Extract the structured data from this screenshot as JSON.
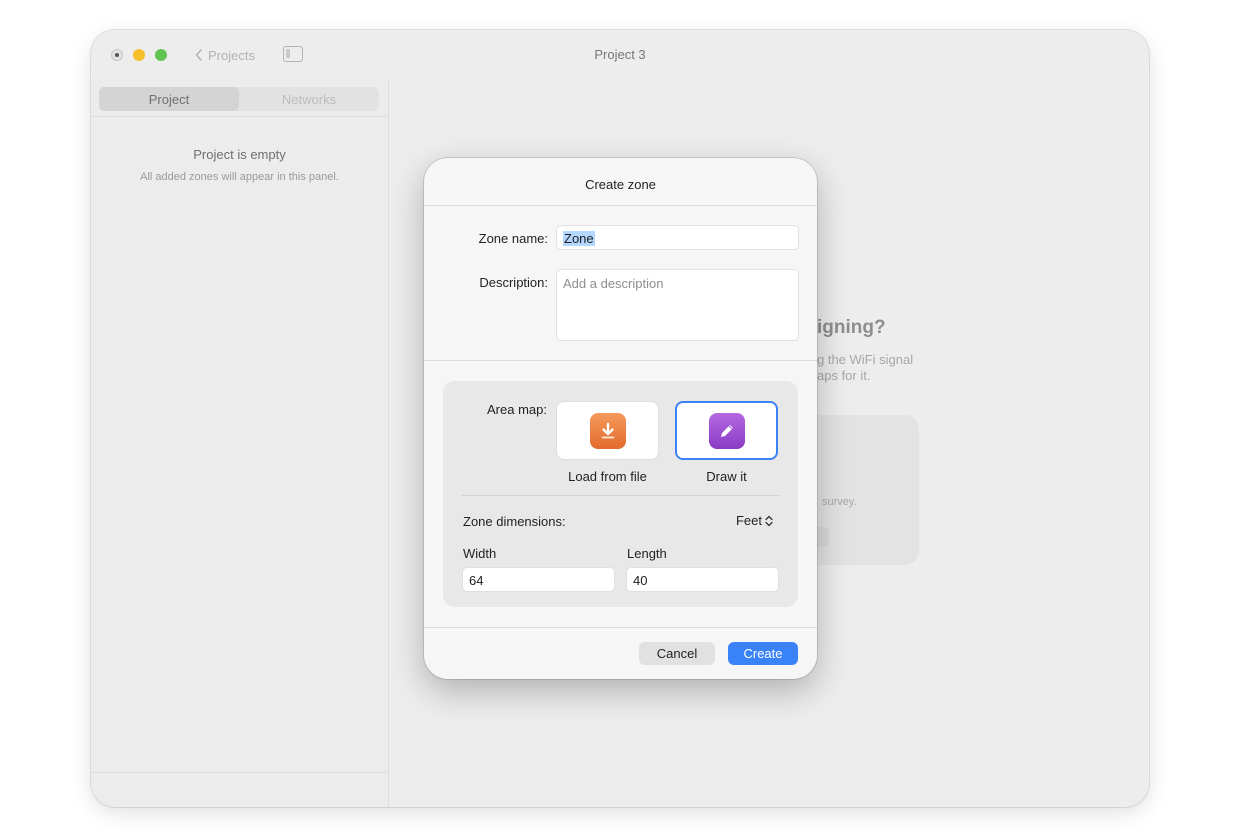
{
  "window": {
    "title": "Project 3",
    "back_label": "Projects"
  },
  "sidebar": {
    "tabs": [
      {
        "label": "Project",
        "active": true
      },
      {
        "label": "Networks",
        "active": false
      }
    ],
    "empty_title": "Project is empty",
    "empty_subtitle": "All added zones will appear in this panel."
  },
  "background": {
    "heading": "igning?",
    "text_line1": "g the WiFi signal",
    "text_line2": "aps for it.",
    "card_text": "survey."
  },
  "dialog": {
    "title": "Create zone",
    "zone_name_label": "Zone name:",
    "zone_name_value": "Zone",
    "description_label": "Description:",
    "description_placeholder": "Add a description",
    "area_map_label": "Area map:",
    "options": [
      {
        "label": "Load from file",
        "icon": "download-icon",
        "selected": false
      },
      {
        "label": "Draw it",
        "icon": "pencil-icon",
        "selected": true
      }
    ],
    "zone_dimensions_label": "Zone dimensions:",
    "unit": "Feet",
    "width_label": "Width",
    "width_value": "64",
    "length_label": "Length",
    "length_value": "40",
    "cancel_label": "Cancel",
    "create_label": "Create"
  },
  "colors": {
    "accent": "#3a82f7",
    "load_icon": "#ec7a3c",
    "draw_icon": "#9b4fd3",
    "close": "#e3e3e3",
    "minimize": "#f5bf2e",
    "zoom": "#5fc450"
  }
}
